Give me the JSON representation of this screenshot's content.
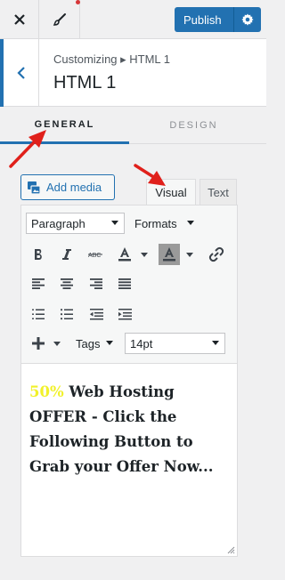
{
  "topbar": {
    "close_icon": "close-icon",
    "brush_icon": "brush-icon",
    "publish_label": "Publish",
    "gear_icon": "gear-icon"
  },
  "header": {
    "breadcrumb": "Customizing ▸ HTML 1",
    "title": "HTML 1"
  },
  "tabs": [
    {
      "label": "GENERAL",
      "active": true
    },
    {
      "label": "DESIGN",
      "active": false
    }
  ],
  "editor": {
    "add_media_label": "Add media",
    "mode_tabs": [
      {
        "label": "Visual",
        "active": true
      },
      {
        "label": "Text",
        "active": false
      }
    ],
    "format_select": "Paragraph",
    "formats_menu": "Formats",
    "tags_menu": "Tags",
    "font_size_select": "14pt",
    "toolbar_icons": [
      "bold-icon",
      "italic-icon",
      "strikethrough-icon",
      "text-color-icon",
      "background-color-icon",
      "link-icon",
      "align-left-icon",
      "align-center-icon",
      "align-right-icon",
      "align-justify-icon",
      "ordered-list-icon",
      "bullet-list-icon",
      "outdent-icon",
      "indent-icon",
      "insert-icon"
    ],
    "content_highlight": "50%",
    "content_text": " Web Hosting OFFER - Click the Following Button to Grab your Offer Now...",
    "highlight_color": "#f1f12a"
  },
  "colors": {
    "accent": "#2271b1",
    "annotation_arrow": "#e0201b"
  }
}
